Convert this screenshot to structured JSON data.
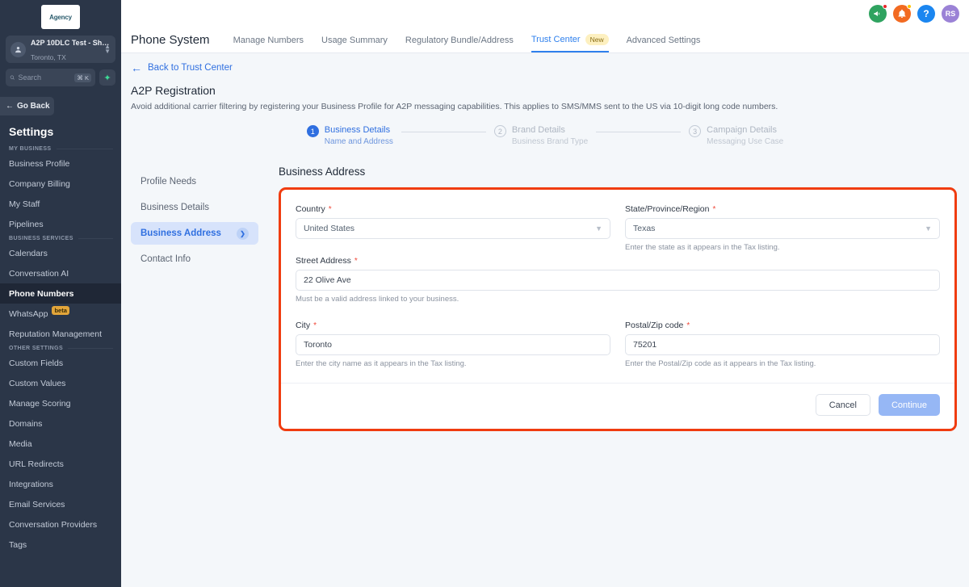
{
  "sidebar": {
    "logo_text": "Agency",
    "account": {
      "name": "A2P 10DLC Test - Sh…",
      "location": "Toronto, TX",
      "icon": "user-circle-icon"
    },
    "search": {
      "placeholder": "Search",
      "shortcut": "⌘ K",
      "spark_icon": "sparkle-icon"
    },
    "go_back": "Go Back",
    "title": "Settings",
    "sections": [
      {
        "heading": "MY BUSINESS",
        "items": [
          {
            "label": "Business Profile",
            "active": false
          },
          {
            "label": "Company Billing",
            "active": false
          },
          {
            "label": "My Staff",
            "active": false
          },
          {
            "label": "Pipelines",
            "active": false
          }
        ]
      },
      {
        "heading": "BUSINESS SERVICES",
        "items": [
          {
            "label": "Calendars",
            "active": false
          },
          {
            "label": "Conversation AI",
            "active": false
          },
          {
            "label": "Phone Numbers",
            "active": true
          },
          {
            "label": "WhatsApp",
            "active": false,
            "badge": "beta"
          },
          {
            "label": "Reputation Management",
            "active": false
          }
        ]
      },
      {
        "heading": "OTHER SETTINGS",
        "items": [
          {
            "label": "Custom Fields",
            "active": false
          },
          {
            "label": "Custom Values",
            "active": false
          },
          {
            "label": "Manage Scoring",
            "active": false
          },
          {
            "label": "Domains",
            "active": false
          },
          {
            "label": "Media",
            "active": false
          },
          {
            "label": "URL Redirects",
            "active": false
          },
          {
            "label": "Integrations",
            "active": false
          },
          {
            "label": "Email Services",
            "active": false
          },
          {
            "label": "Conversation Providers",
            "active": false
          },
          {
            "label": "Tags",
            "active": false
          }
        ]
      }
    ]
  },
  "topbar": {
    "icons": [
      {
        "name": "announcement-icon",
        "glyph": "📣",
        "color": "#2fa360",
        "dot": "red"
      },
      {
        "name": "notifications-bell-icon",
        "glyph": "🔔",
        "color": "#f26a21",
        "dot": "yellow"
      },
      {
        "name": "help-icon",
        "glyph": "?",
        "color": "#1b86f0",
        "dot": "none"
      },
      {
        "name": "user-avatar",
        "glyph": "RS",
        "color": "#9b82d6",
        "dot": "none"
      }
    ]
  },
  "nav": {
    "app_title": "Phone System",
    "tabs": [
      {
        "label": "Manage Numbers",
        "active": false
      },
      {
        "label": "Usage Summary",
        "active": false
      },
      {
        "label": "Regulatory Bundle/Address",
        "active": false
      },
      {
        "label": "Trust Center",
        "active": true,
        "badge": "New"
      },
      {
        "label": "Advanced Settings",
        "active": false
      }
    ]
  },
  "page": {
    "back_link": "Back to Trust Center",
    "title": "A2P Registration",
    "subtitle": "Avoid additional carrier filtering by registering your Business Profile for A2P messaging capabilities. This applies to SMS/MMS sent to the US via 10-digit long code numbers.",
    "steps": [
      {
        "num": "1",
        "label": "Business Details",
        "sub": "Name and Address",
        "state": "active"
      },
      {
        "num": "2",
        "label": "Brand Details",
        "sub": "Business Brand Type",
        "state": "inactive"
      },
      {
        "num": "3",
        "label": "Campaign Details",
        "sub": "Messaging Use Case",
        "state": "inactive"
      }
    ]
  },
  "subnav": {
    "items": [
      {
        "label": "Profile Needs",
        "active": false
      },
      {
        "label": "Business Details",
        "active": false
      },
      {
        "label": "Business Address",
        "active": true
      },
      {
        "label": "Contact Info",
        "active": false
      }
    ]
  },
  "form": {
    "heading": "Business Address",
    "highlight_color": "#f03c10",
    "fields": {
      "country": {
        "label": "Country",
        "required": "*",
        "value": "United States",
        "type": "select"
      },
      "state": {
        "label": "State/Province/Region",
        "required": "*",
        "value": "Texas",
        "type": "select",
        "hint": "Enter the state as it appears in the Tax listing."
      },
      "street": {
        "label": "Street Address",
        "required": "*",
        "value": "22 Olive Ave",
        "type": "text",
        "hint": "Must be a valid address linked to your business."
      },
      "city": {
        "label": "City",
        "required": "*",
        "value": "Toronto",
        "type": "text",
        "hint": "Enter the city name as it appears in the Tax listing."
      },
      "postal": {
        "label": "Postal/Zip code",
        "required": "*",
        "value": "75201",
        "type": "text",
        "hint": "Enter the Postal/Zip code as it appears in the Tax listing."
      }
    },
    "cancel_label": "Cancel",
    "continue_label": "Continue"
  }
}
